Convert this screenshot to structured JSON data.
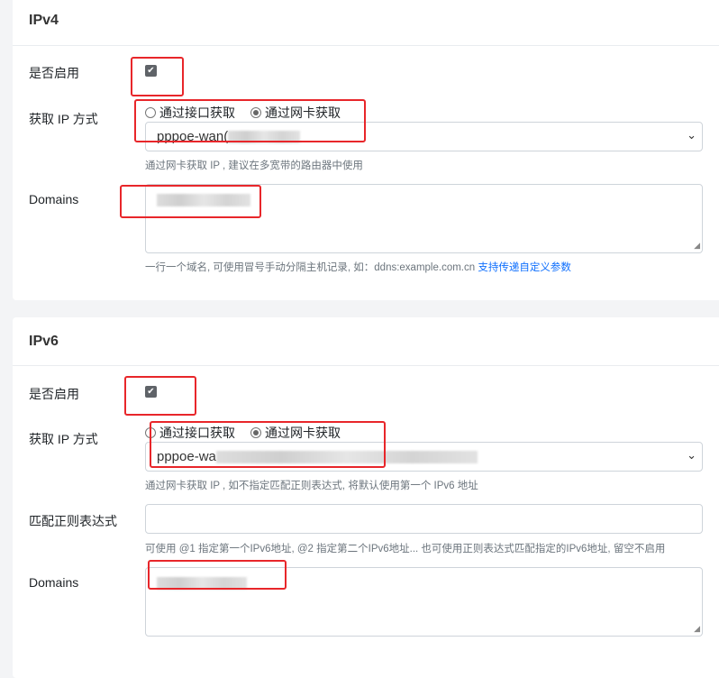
{
  "ipv4": {
    "title": "IPv4",
    "enable_label": "是否启用",
    "enabled": true,
    "method_label": "获取 IP 方式",
    "radio_interface": "通过接口获取",
    "radio_netcard": "通过网卡获取",
    "selected": "netcard",
    "select_value": "pppoe-wan(",
    "method_help": "通过网卡获取 IP , 建议在多宽带的路由器中使用",
    "domains_label": "Domains",
    "domains_help": "一行一个域名, 可使用冒号手动分隔主机记录, 如：ddns:example.com.cn ",
    "domains_link": "支持传递自定义参数"
  },
  "ipv6": {
    "title": "IPv6",
    "enable_label": "是否启用",
    "enabled": true,
    "method_label": "获取 IP 方式",
    "radio_interface": "通过接口获取",
    "radio_netcard": "通过网卡获取",
    "selected": "netcard",
    "select_value": "pppoe-wa",
    "method_help": "通过网卡获取 IP , 如不指定匹配正则表达式, 将默认使用第一个 IPv6 地址",
    "regex_label": "匹配正则表达式",
    "regex_value": "",
    "regex_help": "可使用 @1 指定第一个IPv6地址, @2 指定第二个IPv6地址... 也可使用正则表达式匹配指定的IPv6地址, 留空不启用",
    "domains_label": "Domains"
  },
  "icons": {
    "select": "chevron-down-icon",
    "check": "checkmark-icon"
  }
}
